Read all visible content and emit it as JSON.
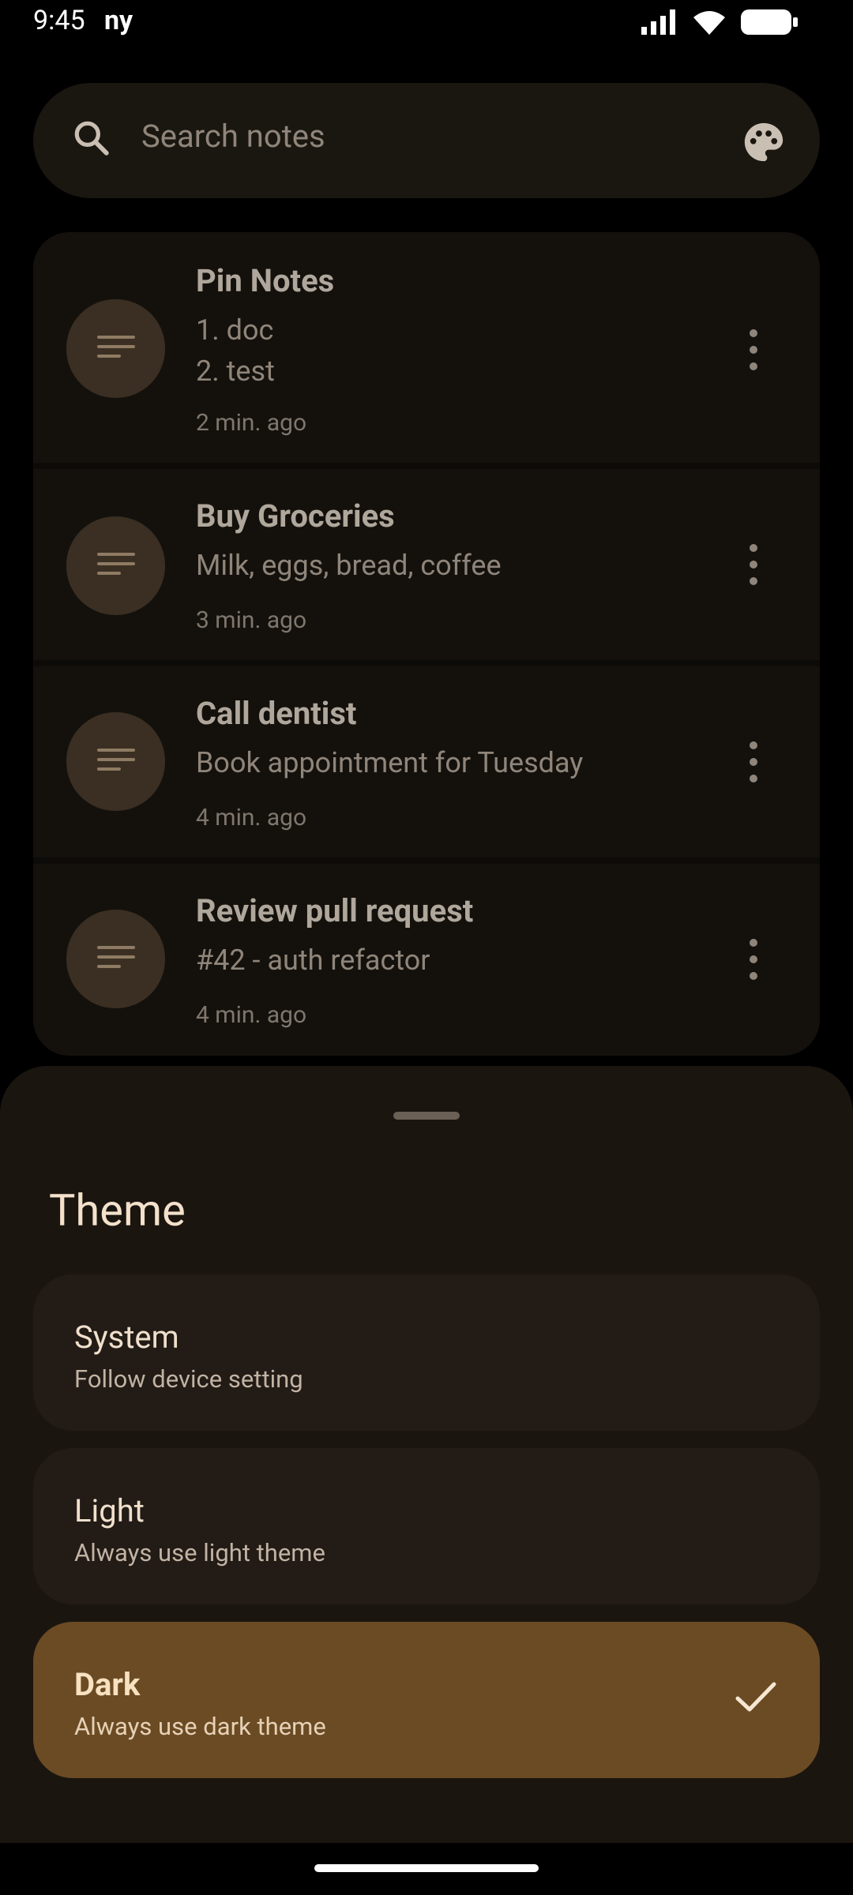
{
  "status": {
    "time": "9:45",
    "carrier": "ny"
  },
  "search": {
    "placeholder": "Search notes",
    "icon_left": "search-icon",
    "icon_right": "palette-icon"
  },
  "notes": [
    {
      "title": "Pin Notes",
      "body": "1. doc\n2. test",
      "time": "2 min. ago"
    },
    {
      "title": "Buy Groceries",
      "body": "Milk, eggs, bread, coffee",
      "time": "3 min. ago"
    },
    {
      "title": "Call dentist",
      "body": "Book appointment for Tuesday",
      "time": "4 min. ago"
    },
    {
      "title": "Review pull request",
      "body": "#42 - auth refactor",
      "time": "4 min. ago"
    }
  ],
  "sheet": {
    "title": "Theme",
    "options": [
      {
        "label": "System",
        "desc": "Follow device setting",
        "selected": false
      },
      {
        "label": "Light",
        "desc": "Always use light theme",
        "selected": false
      },
      {
        "label": "Dark",
        "desc": "Always use dark theme",
        "selected": true
      }
    ]
  },
  "colors": {
    "accent": "#6b4b23",
    "background": "#000000",
    "card": "#14110d",
    "sheet": "#1b1510"
  }
}
